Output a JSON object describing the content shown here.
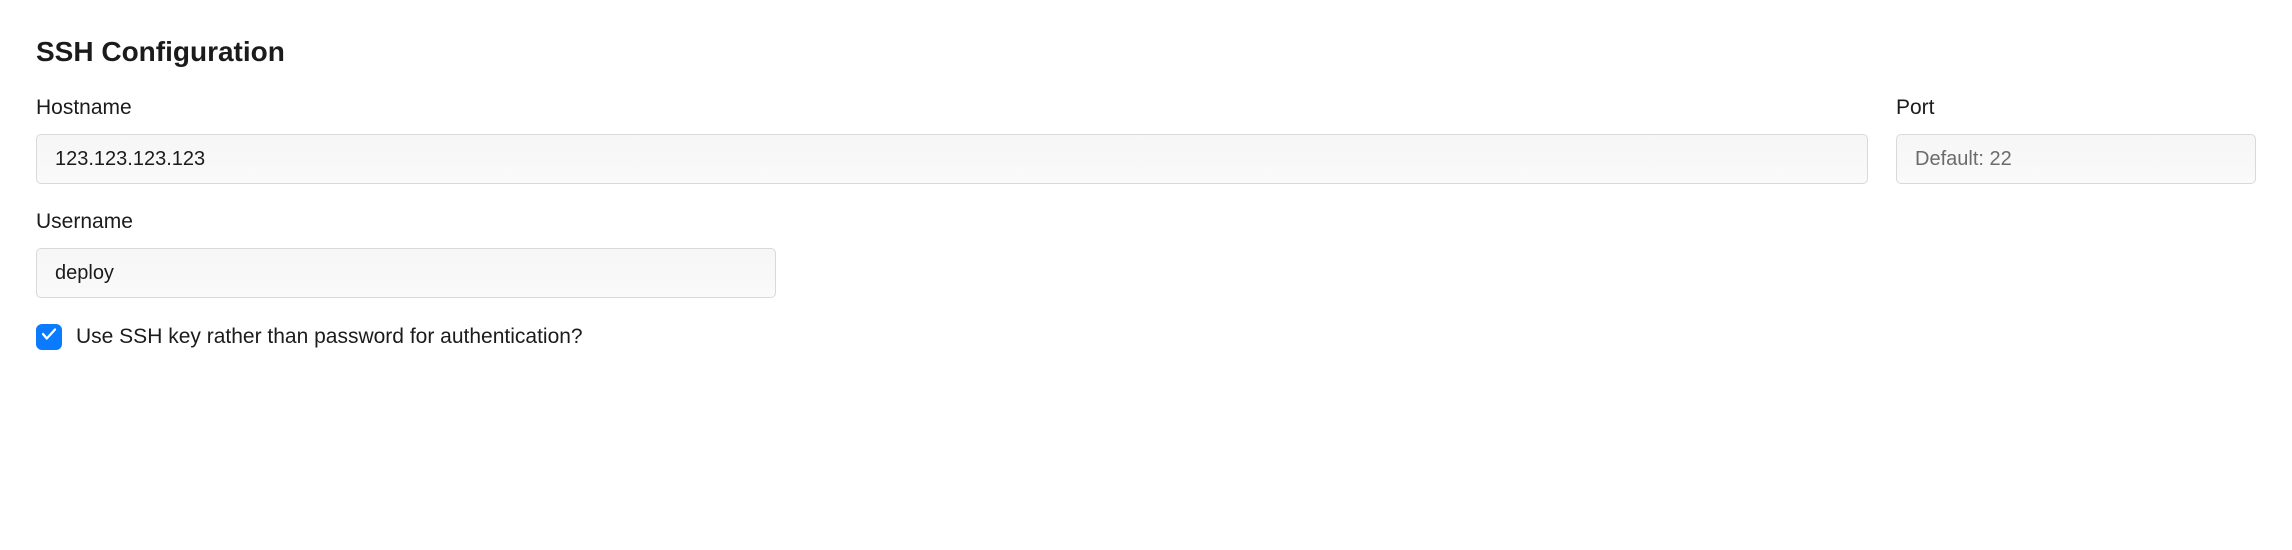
{
  "section": {
    "title": "SSH Configuration"
  },
  "fields": {
    "hostname": {
      "label": "Hostname",
      "value": "123.123.123.123",
      "placeholder": ""
    },
    "port": {
      "label": "Port",
      "value": "",
      "placeholder": "Default: 22"
    },
    "username": {
      "label": "Username",
      "value": "deploy",
      "placeholder": ""
    }
  },
  "checkbox": {
    "use_ssh_key": {
      "label": "Use SSH key rather than password for authentication?",
      "checked": true
    }
  }
}
